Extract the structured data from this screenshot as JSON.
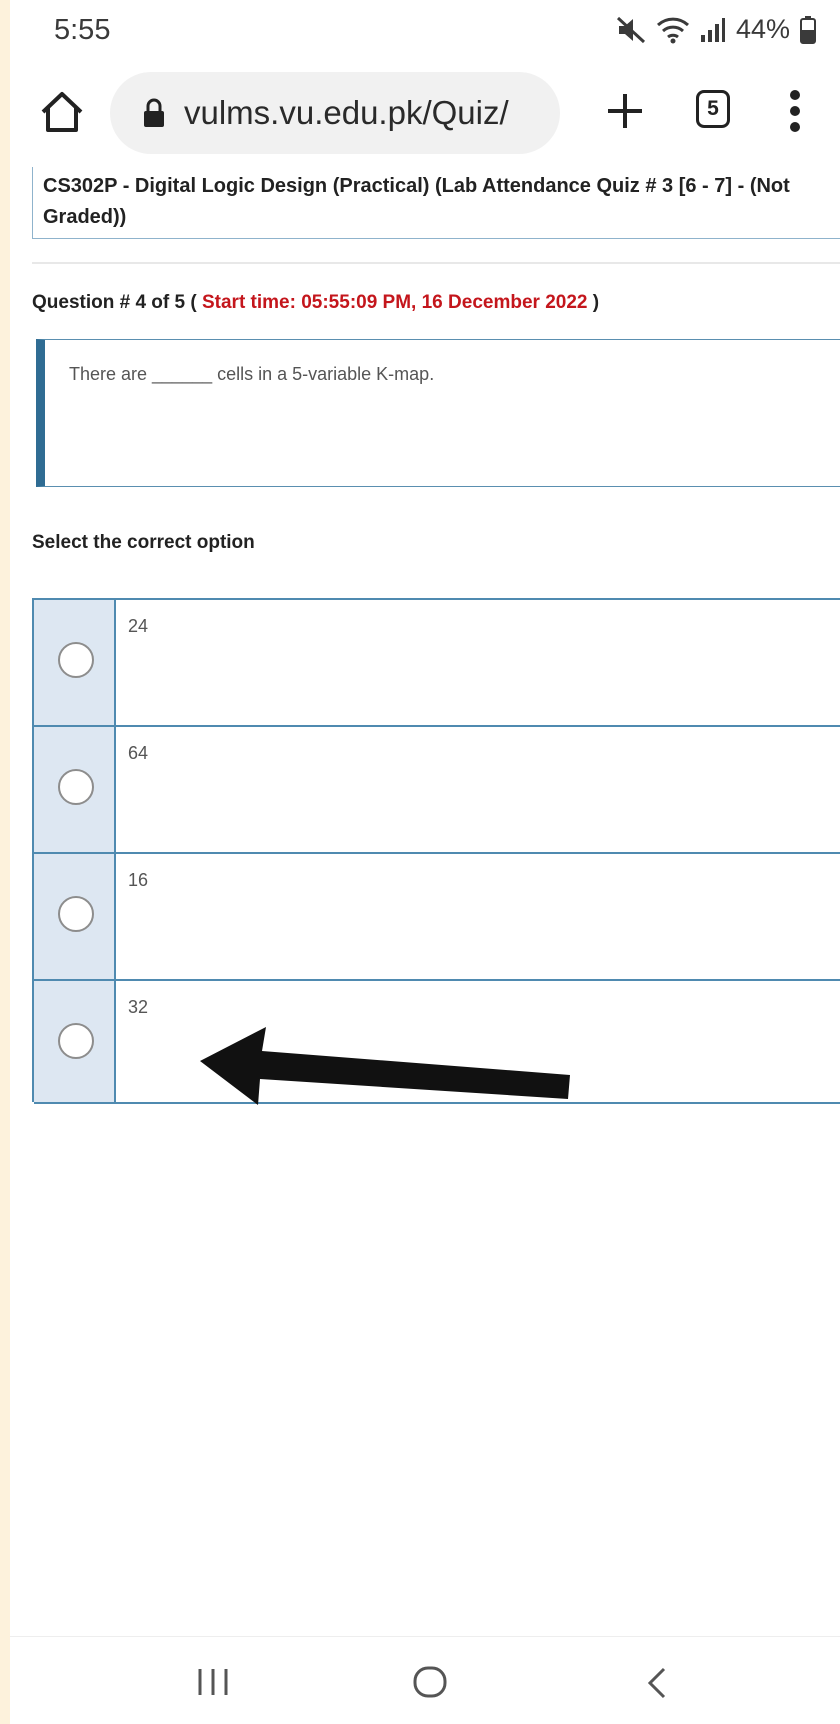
{
  "status_bar": {
    "time": "5:55",
    "battery": "44%"
  },
  "browser": {
    "url": "vulms.vu.edu.pk/Quiz/",
    "tab_count": "5",
    "icons": [
      "home-icon",
      "lock-icon",
      "plus-icon",
      "tabs-icon",
      "more-vert-icon"
    ]
  },
  "quiz": {
    "title": "CS302P - Digital Logic Design (Practical) (Lab Attendance Quiz # 3 [6 - 7] - (Not Graded))",
    "question_label": "Question # 4 of 5 (",
    "start_time": "Start time: 05:55:09 PM, 16 December 2022",
    "question_close": ")",
    "question_text": "There are ______ cells in a 5-variable K-map.",
    "select_label": "Select the correct option",
    "options": [
      {
        "label": "24"
      },
      {
        "label": "64"
      },
      {
        "label": "16"
      },
      {
        "label": "32"
      }
    ]
  },
  "colors": {
    "accent": "#2f6c93",
    "time_red": "#c4161c",
    "radio_cell": "#dde7f2"
  },
  "nav_bar": {
    "icons": [
      "recent-apps-icon",
      "home-circle-icon",
      "back-icon"
    ]
  }
}
